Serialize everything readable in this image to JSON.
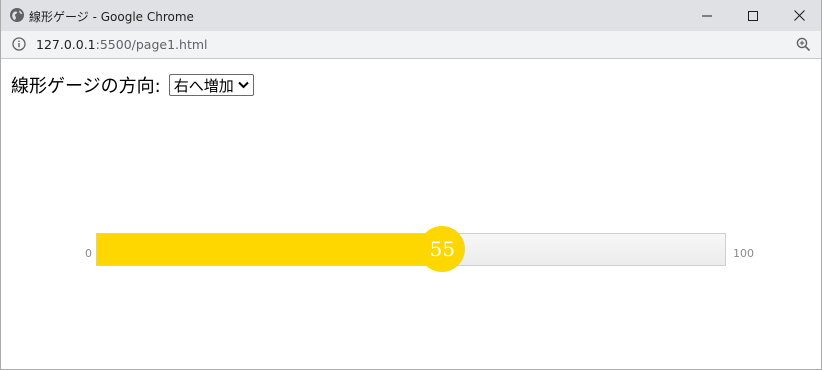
{
  "window": {
    "title": "線形ゲージ - Google Chrome"
  },
  "address": {
    "host": "127.0.0.1",
    "path": ":5500/page1.html"
  },
  "page": {
    "direction_label": "線形ゲージの方向:",
    "direction_select": {
      "selected": "右へ増加"
    },
    "gauge": {
      "min_label": "0",
      "max_label": "100",
      "value": 55,
      "value_label": "55",
      "fill_color": "#ffd700",
      "track_color": "#f0f0f0"
    }
  },
  "icons": {
    "globe": "globe-icon",
    "info": "info-icon",
    "zoom": "zoom-in-icon",
    "minimize": "minimize-icon",
    "maximize": "maximize-icon",
    "close": "close-icon",
    "dropdown": "chevron-down-icon"
  }
}
